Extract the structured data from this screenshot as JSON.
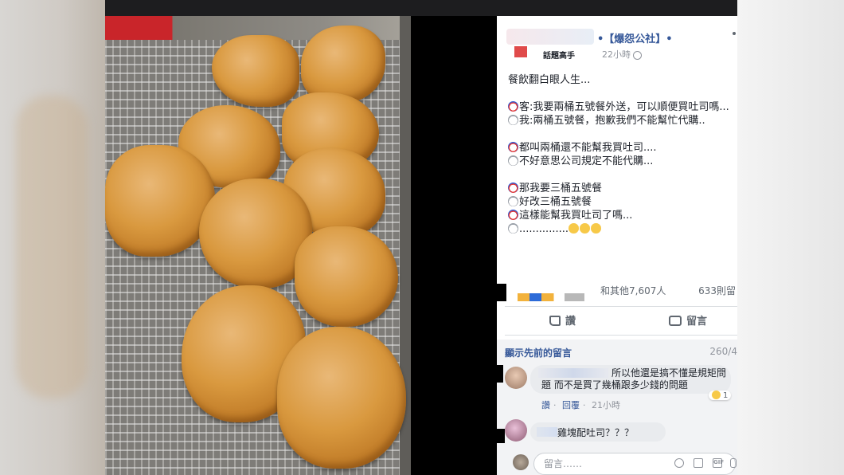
{
  "post": {
    "page_name": "•【爆怨公社】•",
    "author_badge": "話題高手",
    "time": "22小時",
    "lines": [
      {
        "text": "餐飲翻白眼人生...",
        "emoji": []
      },
      {
        "text": "",
        "emoji": []
      },
      {
        "text": "客:我要兩桶五號餐外送，可以順便買吐司嗎...",
        "emoji": [
          "clown"
        ]
      },
      {
        "text": "我:兩桶五號餐，抱歉我們不能幫忙代購..",
        "emoji": [
          "ghost"
        ]
      },
      {
        "text": "",
        "emoji": []
      },
      {
        "text": "都叫兩桶還不能幫我買吐司....",
        "emoji": [
          "clown"
        ]
      },
      {
        "text": "不好意思公司規定不能代購...",
        "emoji": [
          "ghost"
        ]
      },
      {
        "text": "",
        "emoji": []
      },
      {
        "text": "那我要三桶五號餐",
        "emoji": [
          "clown"
        ]
      },
      {
        "text": "好改三桶五號餐",
        "emoji": [
          "ghost"
        ]
      },
      {
        "text": "這樣能幫我買吐司了嗎...",
        "emoji": [
          "clown"
        ]
      },
      {
        "text": "...............",
        "emoji": [
          "ghost"
        ],
        "trailing": [
          "meh",
          "meh",
          "meh"
        ]
      }
    ]
  },
  "reactions": {
    "summary": "和其他7,607人",
    "comments": "633則留"
  },
  "actions": {
    "like": "讚",
    "comment": "留言"
  },
  "comments": {
    "show_previous": "顯示先前的留言",
    "count": "260/4",
    "items": [
      {
        "text": "所以他還是搞不懂是規矩問題 而不是買了幾桶跟多少錢的問題",
        "reaction_count": "1",
        "like": "讚",
        "reply": "回覆",
        "time": "21小時"
      },
      {
        "text": "雞塊配吐司？？？"
      }
    ],
    "input_placeholder": "留言……"
  },
  "colors": {
    "link": "#365899",
    "meta": "#90949c",
    "text": "#1d2129"
  },
  "icons": [
    "globe-icon",
    "like-icon",
    "comment-icon",
    "haha-icon",
    "smile-icon",
    "camera-icon",
    "gif-icon",
    "sticker-icon"
  ]
}
